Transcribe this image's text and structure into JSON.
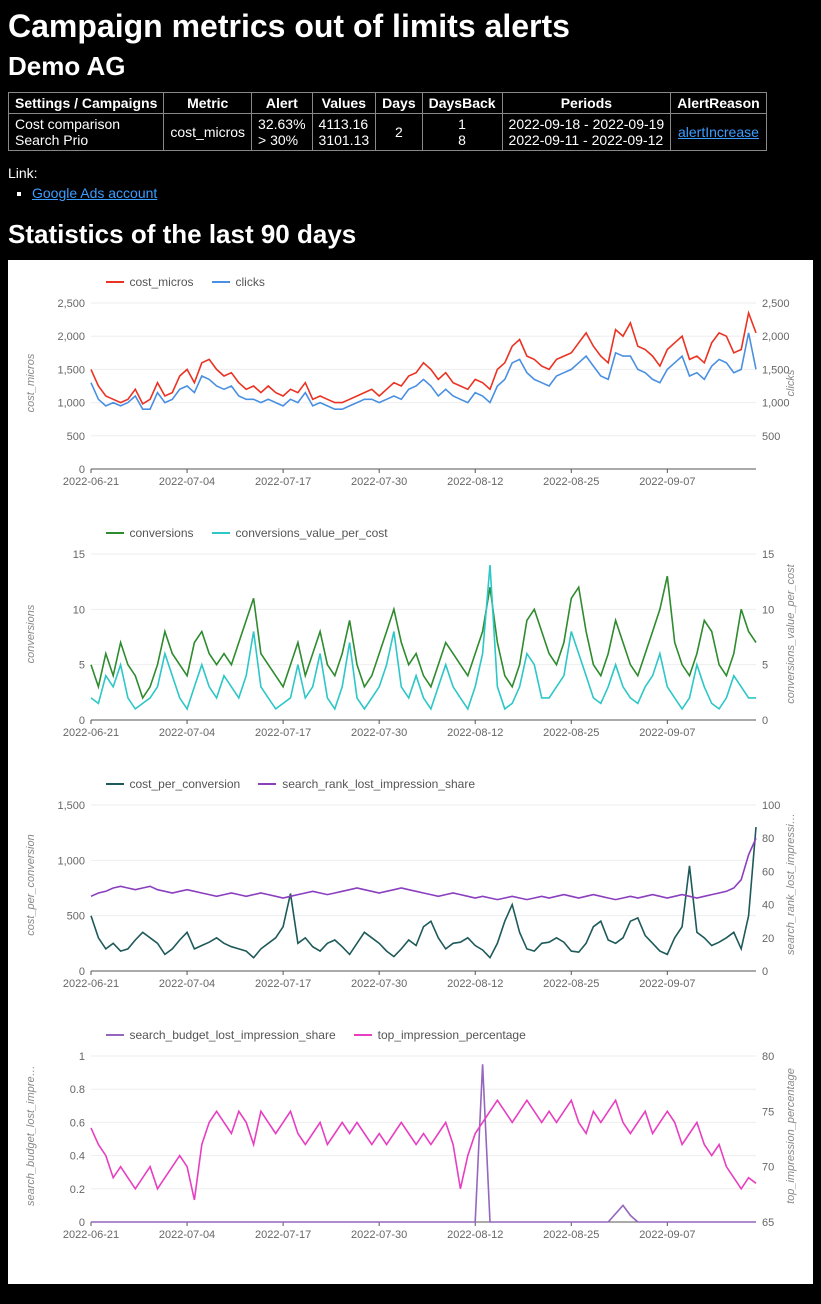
{
  "title": "Campaign metrics out of limits alerts",
  "subtitle": "Demo AG",
  "table": {
    "headers": [
      "Settings / Campaigns",
      "Metric",
      "Alert",
      "Values",
      "Days",
      "DaysBack",
      "Periods",
      "AlertReason"
    ],
    "row": {
      "settings_campaigns_l1": "Cost comparison",
      "settings_campaigns_l2": "Search Prio",
      "metric": "cost_micros",
      "alert_l1": "32.63%",
      "alert_l2": "> 30%",
      "values_l1": "4113.16",
      "values_l2": "3101.13",
      "days": "2",
      "daysback_l1": "1",
      "daysback_l2": "8",
      "periods_l1": "2022-09-18 - 2022-09-19",
      "periods_l2": "2022-09-11 - 2022-09-12",
      "alert_reason": "alertIncrease"
    }
  },
  "link_label": "Link:",
  "link_text": "Google Ads account",
  "stats_heading": "Statistics of the last 90 days",
  "x_ticks": [
    "2022-06-21",
    "2022-07-04",
    "2022-07-17",
    "2022-07-30",
    "2022-08-12",
    "2022-08-25",
    "2022-09-07"
  ],
  "charts": [
    {
      "id": "chart1",
      "y1label": "cost_micros",
      "y2label": "clicks",
      "y1ticks": [
        0,
        500,
        1000,
        1500,
        2000,
        2500
      ],
      "y1range": [
        0,
        2500
      ],
      "y2ticks": [
        500,
        1000,
        1500,
        2000,
        2500
      ],
      "y2range": [
        0,
        2500
      ],
      "series": [
        {
          "name": "cost_micros",
          "color": "#ea3323",
          "axis": "y1"
        },
        {
          "name": "clicks",
          "color": "#4a90e2",
          "axis": "y2"
        }
      ]
    },
    {
      "id": "chart2",
      "y1label": "conversions",
      "y2label": "conversions_value_per_cost",
      "y1ticks": [
        0,
        5,
        10,
        15
      ],
      "y1range": [
        0,
        15
      ],
      "y2ticks": [
        0,
        5,
        10,
        15
      ],
      "y2range": [
        0,
        15
      ],
      "series": [
        {
          "name": "conversions",
          "color": "#2e8b2e",
          "axis": "y1"
        },
        {
          "name": "conversions_value_per_cost",
          "color": "#2dc7c7",
          "axis": "y2"
        }
      ]
    },
    {
      "id": "chart3",
      "y1label": "cost_per_conversion",
      "y2label": "search_rank_lost_impressi…",
      "y1ticks": [
        0,
        500,
        1000,
        1500
      ],
      "y1range": [
        0,
        1500
      ],
      "y2ticks": [
        0,
        20,
        40,
        60,
        80,
        100
      ],
      "y2range": [
        0,
        100
      ],
      "series": [
        {
          "name": "cost_per_conversion",
          "color": "#1f5a5a",
          "axis": "y1"
        },
        {
          "name": "search_rank_lost_impression_share",
          "color": "#8a3fbf",
          "axis": "y2"
        }
      ]
    },
    {
      "id": "chart4",
      "y1label": "search_budget_lost_impre…",
      "y2label": "top_impression_percentage",
      "y1ticks": [
        0.0,
        0.2,
        0.4,
        0.6,
        0.8,
        1.0
      ],
      "y1range": [
        0,
        1
      ],
      "y2ticks": [
        65,
        70,
        75,
        80
      ],
      "y2range": [
        65,
        80
      ],
      "series": [
        {
          "name": "search_budget_lost_impression_share",
          "color": "#9467bd",
          "axis": "y1"
        },
        {
          "name": "top_impression_percentage",
          "color": "#e83fc1",
          "axis": "y2"
        }
      ]
    }
  ],
  "chart_data": [
    {
      "type": "line",
      "title": "cost_micros & clicks, last 90 days",
      "xlabel": "",
      "ylabel": "cost_micros",
      "y2label": "clicks",
      "ylim": [
        0,
        2500
      ],
      "y2lim": [
        0,
        2500
      ],
      "x": [
        "2022-06-21",
        "2022-06-22",
        "2022-06-23",
        "2022-06-24",
        "2022-06-25",
        "2022-06-26",
        "2022-06-27",
        "2022-06-28",
        "2022-06-29",
        "2022-06-30",
        "2022-07-01",
        "2022-07-02",
        "2022-07-03",
        "2022-07-04",
        "2022-07-05",
        "2022-07-06",
        "2022-07-07",
        "2022-07-08",
        "2022-07-09",
        "2022-07-10",
        "2022-07-11",
        "2022-07-12",
        "2022-07-13",
        "2022-07-14",
        "2022-07-15",
        "2022-07-16",
        "2022-07-17",
        "2022-07-18",
        "2022-07-19",
        "2022-07-20",
        "2022-07-21",
        "2022-07-22",
        "2022-07-23",
        "2022-07-24",
        "2022-07-25",
        "2022-07-26",
        "2022-07-27",
        "2022-07-28",
        "2022-07-29",
        "2022-07-30",
        "2022-07-31",
        "2022-08-01",
        "2022-08-02",
        "2022-08-03",
        "2022-08-04",
        "2022-08-05",
        "2022-08-06",
        "2022-08-07",
        "2022-08-08",
        "2022-08-09",
        "2022-08-10",
        "2022-08-11",
        "2022-08-12",
        "2022-08-13",
        "2022-08-14",
        "2022-08-15",
        "2022-08-16",
        "2022-08-17",
        "2022-08-18",
        "2022-08-19",
        "2022-08-20",
        "2022-08-21",
        "2022-08-22",
        "2022-08-23",
        "2022-08-24",
        "2022-08-25",
        "2022-08-26",
        "2022-08-27",
        "2022-08-28",
        "2022-08-29",
        "2022-08-30",
        "2022-08-31",
        "2022-09-01",
        "2022-09-02",
        "2022-09-03",
        "2022-09-04",
        "2022-09-05",
        "2022-09-06",
        "2022-09-07",
        "2022-09-08",
        "2022-09-09",
        "2022-09-10",
        "2022-09-11",
        "2022-09-12",
        "2022-09-13",
        "2022-09-14",
        "2022-09-15",
        "2022-09-16",
        "2022-09-17",
        "2022-09-18",
        "2022-09-19"
      ],
      "series": [
        {
          "name": "cost_micros",
          "values": [
            1500,
            1250,
            1100,
            1050,
            1000,
            1050,
            1200,
            980,
            1050,
            1300,
            1100,
            1150,
            1400,
            1500,
            1300,
            1600,
            1650,
            1500,
            1400,
            1450,
            1300,
            1200,
            1250,
            1150,
            1250,
            1150,
            1100,
            1200,
            1150,
            1300,
            1050,
            1100,
            1050,
            1000,
            1000,
            1050,
            1100,
            1150,
            1200,
            1100,
            1200,
            1300,
            1250,
            1400,
            1450,
            1600,
            1500,
            1350,
            1450,
            1300,
            1250,
            1200,
            1350,
            1300,
            1200,
            1500,
            1600,
            1850,
            1950,
            1700,
            1650,
            1550,
            1500,
            1650,
            1700,
            1750,
            1900,
            2050,
            1850,
            1700,
            1600,
            2100,
            2000,
            2200,
            1850,
            1800,
            1700,
            1550,
            1800,
            1900,
            2000,
            1650,
            1700,
            1600,
            1900,
            2050,
            2000,
            1750,
            1800,
            2350,
            2050
          ]
        },
        {
          "name": "clicks",
          "values": [
            1300,
            1050,
            950,
            1000,
            950,
            1000,
            1100,
            900,
            900,
            1150,
            1000,
            1050,
            1200,
            1250,
            1150,
            1400,
            1350,
            1250,
            1200,
            1250,
            1100,
            1050,
            1050,
            1000,
            1050,
            1000,
            950,
            1050,
            1000,
            1150,
            950,
            1000,
            950,
            900,
            900,
            950,
            1000,
            1050,
            1050,
            1000,
            1050,
            1100,
            1050,
            1200,
            1250,
            1350,
            1250,
            1100,
            1200,
            1100,
            1050,
            1000,
            1150,
            1100,
            1000,
            1250,
            1350,
            1600,
            1650,
            1450,
            1350,
            1300,
            1250,
            1400,
            1450,
            1500,
            1600,
            1700,
            1550,
            1400,
            1350,
            1750,
            1700,
            1700,
            1500,
            1450,
            1350,
            1300,
            1500,
            1600,
            1700,
            1400,
            1450,
            1350,
            1550,
            1650,
            1600,
            1450,
            1500,
            2050,
            1500
          ]
        }
      ]
    },
    {
      "type": "line",
      "title": "conversions & conversions_value_per_cost, last 90 days",
      "xlabel": "",
      "ylabel": "conversions",
      "y2label": "conversions_value_per_cost",
      "ylim": [
        0,
        15
      ],
      "y2lim": [
        0,
        15
      ],
      "x_shared_with": 0,
      "series": [
        {
          "name": "conversions",
          "values": [
            5,
            3,
            6,
            4,
            7,
            5,
            4,
            2,
            3,
            5,
            8,
            6,
            5,
            4,
            7,
            8,
            6,
            5,
            6,
            5,
            7,
            9,
            11,
            6,
            5,
            4,
            3,
            5,
            7,
            4,
            6,
            8,
            5,
            4,
            6,
            9,
            5,
            3,
            4,
            6,
            8,
            10,
            7,
            5,
            6,
            4,
            3,
            5,
            7,
            6,
            5,
            4,
            6,
            8,
            12,
            7,
            4,
            3,
            5,
            9,
            10,
            8,
            6,
            5,
            7,
            11,
            12,
            8,
            5,
            4,
            6,
            9,
            7,
            5,
            4,
            6,
            8,
            10,
            13,
            7,
            5,
            4,
            6,
            9,
            8,
            5,
            4,
            6,
            10,
            8,
            7
          ]
        },
        {
          "name": "conversions_value_per_cost",
          "values": [
            2,
            1.5,
            4,
            3,
            5,
            2,
            1,
            1.5,
            2,
            3,
            6,
            4,
            2,
            1,
            3,
            5,
            3,
            2,
            4,
            3,
            2,
            4,
            8,
            3,
            2,
            1,
            1.5,
            2,
            5,
            2,
            3,
            6,
            2,
            1,
            3,
            7,
            2,
            1,
            2,
            3,
            5,
            8,
            3,
            2,
            4,
            2,
            1,
            3,
            5,
            3,
            2,
            1,
            3,
            6,
            14,
            3,
            1,
            1.5,
            3,
            6,
            5,
            2,
            2,
            3,
            4,
            8,
            6,
            4,
            2,
            1.5,
            3,
            5,
            3,
            2,
            1.5,
            3,
            4,
            6,
            3,
            2,
            1,
            2,
            5,
            3,
            1.5,
            1,
            2,
            4,
            3,
            2,
            2
          ]
        }
      ]
    },
    {
      "type": "line",
      "title": "cost_per_conversion & search_rank_lost_impression_share, last 90 days",
      "xlabel": "",
      "ylabel": "cost_per_conversion",
      "y2label": "search_rank_lost_impression_share",
      "ylim": [
        0,
        1500
      ],
      "y2lim": [
        0,
        100
      ],
      "x_shared_with": 0,
      "series": [
        {
          "name": "cost_per_conversion",
          "values": [
            500,
            300,
            200,
            250,
            180,
            200,
            280,
            350,
            300,
            250,
            150,
            200,
            280,
            350,
            200,
            230,
            260,
            300,
            250,
            220,
            200,
            180,
            120,
            200,
            250,
            300,
            400,
            700,
            250,
            300,
            220,
            180,
            250,
            280,
            220,
            150,
            250,
            350,
            300,
            250,
            180,
            130,
            200,
            280,
            230,
            400,
            450,
            300,
            200,
            250,
            260,
            300,
            230,
            190,
            120,
            250,
            450,
            600,
            350,
            200,
            180,
            250,
            260,
            300,
            260,
            180,
            170,
            250,
            400,
            450,
            280,
            250,
            300,
            450,
            480,
            320,
            250,
            180,
            150,
            300,
            400,
            950,
            350,
            300,
            230,
            260,
            300,
            350,
            200,
            500,
            1300
          ]
        },
        {
          "name": "search_rank_lost_impression_share",
          "values": [
            45,
            47,
            48,
            50,
            51,
            50,
            49,
            50,
            51,
            49,
            48,
            47,
            48,
            49,
            48,
            47,
            46,
            45,
            46,
            47,
            46,
            45,
            46,
            47,
            46,
            45,
            44,
            45,
            46,
            47,
            48,
            47,
            46,
            47,
            48,
            49,
            50,
            49,
            48,
            47,
            48,
            49,
            50,
            49,
            48,
            47,
            46,
            45,
            46,
            47,
            46,
            45,
            44,
            45,
            44,
            43,
            44,
            45,
            44,
            43,
            44,
            45,
            44,
            45,
            46,
            45,
            44,
            45,
            46,
            45,
            44,
            43,
            44,
            45,
            44,
            45,
            46,
            45,
            44,
            45,
            46,
            45,
            44,
            45,
            46,
            47,
            48,
            50,
            55,
            70,
            80
          ]
        }
      ]
    },
    {
      "type": "line",
      "title": "search_budget_lost_impression_share & top_impression_percentage, last 90 days",
      "xlabel": "",
      "ylabel": "search_budget_lost_impression_share",
      "y2label": "top_impression_percentage",
      "ylim": [
        0,
        1
      ],
      "y2lim": [
        65,
        80
      ],
      "x_shared_with": 0,
      "series": [
        {
          "name": "search_budget_lost_impression_share",
          "values": [
            0,
            0,
            0,
            0,
            0,
            0,
            0,
            0,
            0,
            0,
            0,
            0,
            0,
            0,
            0,
            0,
            0,
            0,
            0,
            0,
            0,
            0,
            0,
            0,
            0,
            0,
            0,
            0,
            0,
            0,
            0,
            0,
            0,
            0,
            0,
            0,
            0,
            0,
            0,
            0,
            0,
            0,
            0,
            0,
            0,
            0,
            0,
            0,
            0,
            0,
            0,
            0,
            0,
            0.95,
            0,
            0,
            0,
            0,
            0,
            0,
            0,
            0,
            0,
            0,
            0,
            0,
            0,
            0,
            0,
            0,
            0,
            0.05,
            0.1,
            0.04,
            0,
            0,
            0,
            0,
            0,
            0,
            0,
            0,
            0,
            0,
            0,
            0,
            0,
            0,
            0,
            0,
            0
          ]
        },
        {
          "name": "top_impression_percentage",
          "values": [
            73.5,
            72,
            71,
            69,
            70,
            69,
            68,
            69,
            70,
            68,
            69,
            70,
            71,
            70,
            67,
            72,
            74,
            75,
            74,
            73,
            75,
            74,
            72,
            75,
            74,
            73,
            74,
            75,
            73,
            72,
            73,
            74,
            72,
            73,
            74,
            73,
            74,
            73,
            72,
            73,
            72,
            73,
            74,
            73,
            72,
            73,
            72,
            73,
            74,
            72,
            68,
            71,
            73,
            74,
            75,
            76,
            75,
            74,
            75,
            76,
            75,
            74,
            75,
            74,
            75,
            76,
            74,
            73,
            75,
            74,
            75,
            76,
            74,
            73,
            74,
            75,
            73,
            74,
            75,
            74,
            72,
            73,
            74,
            72,
            71,
            72,
            70,
            69,
            68,
            69,
            68.5
          ]
        }
      ]
    }
  ]
}
